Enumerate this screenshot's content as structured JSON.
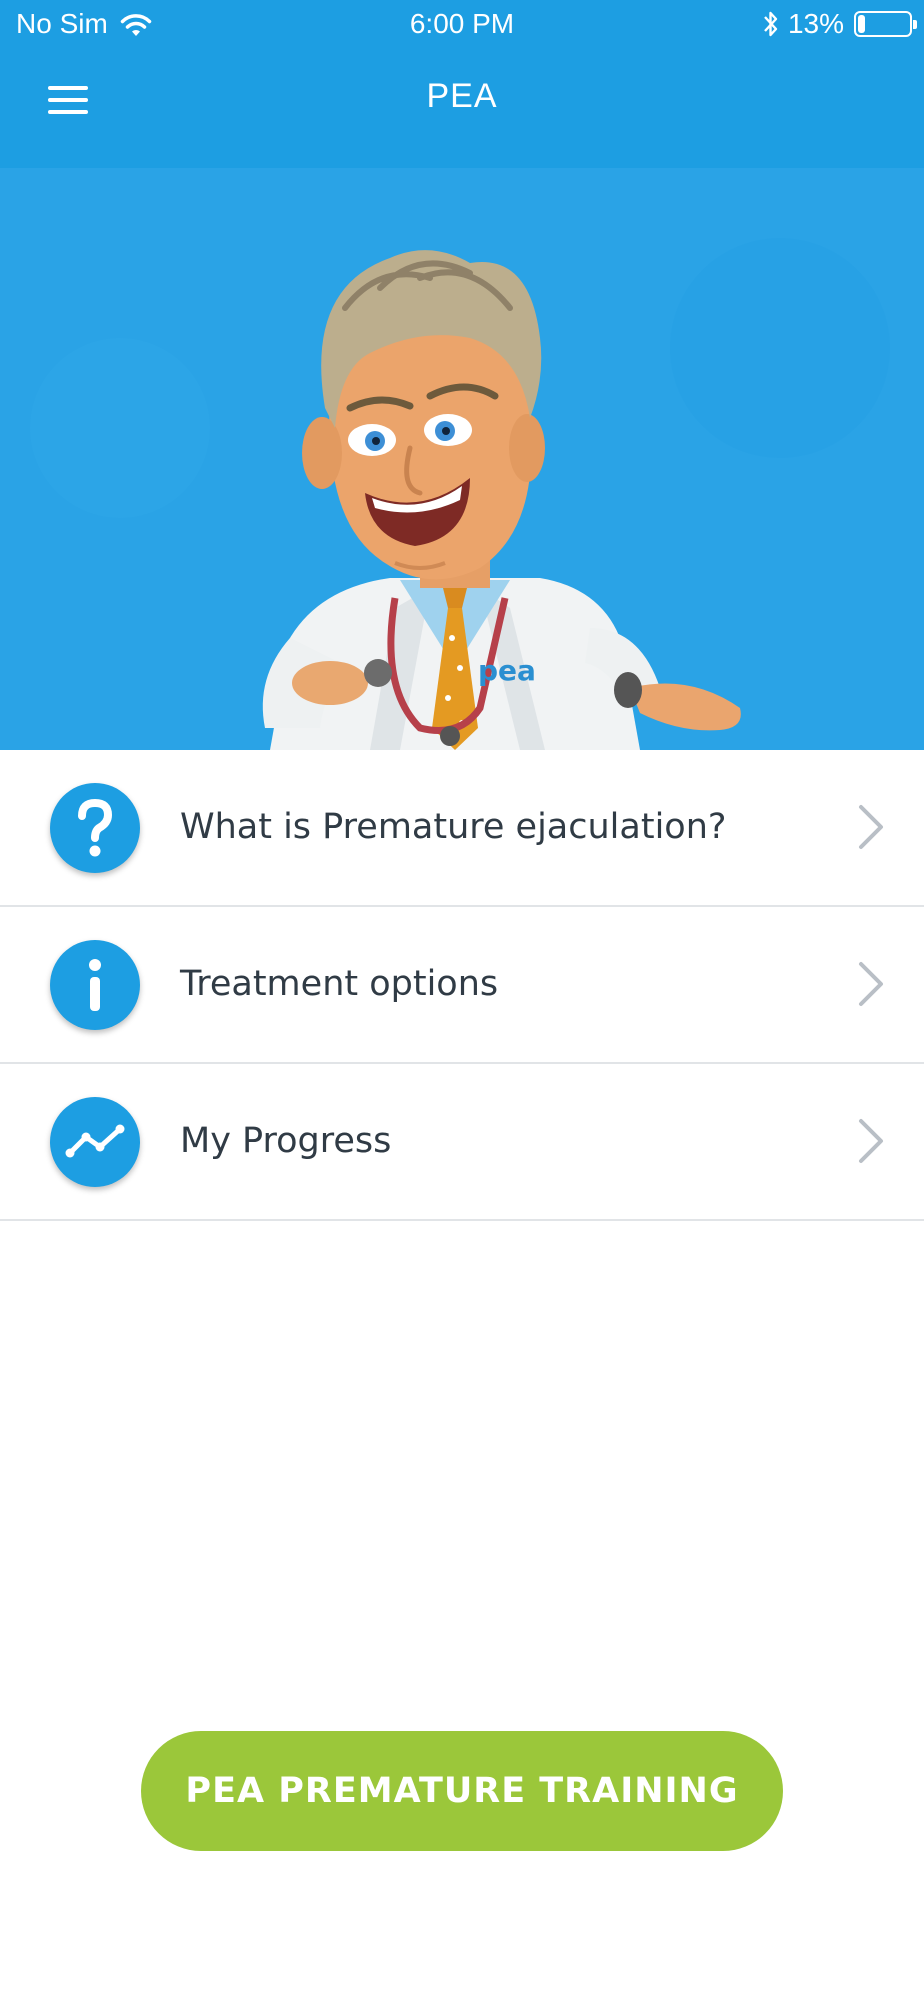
{
  "status_bar": {
    "carrier": "No Sim",
    "time": "6:00 PM",
    "battery_percent": "13%",
    "battery_level": 0.13,
    "icons": [
      "wifi-icon",
      "bluetooth-icon",
      "battery-icon"
    ]
  },
  "nav": {
    "title": "PEA",
    "menu_icon": "hamburger-menu-icon"
  },
  "hero": {
    "image": "cartoon-doctor-illustration",
    "coat_badge": "pea"
  },
  "menu_items": [
    {
      "label": "What is Premature ejaculation?",
      "icon": "question-icon"
    },
    {
      "label": "Treatment options",
      "icon": "info-icon"
    },
    {
      "label": "My Progress",
      "icon": "progress-chart-icon"
    }
  ],
  "cta": {
    "label": "PEA PREMATURE TRAINING"
  },
  "colors": {
    "primary_blue": "#1d9ee2",
    "cta_green": "#9bc73a",
    "text_dark": "#303b45",
    "divider": "#e1e4e7",
    "chevron": "#b9bfc6"
  }
}
